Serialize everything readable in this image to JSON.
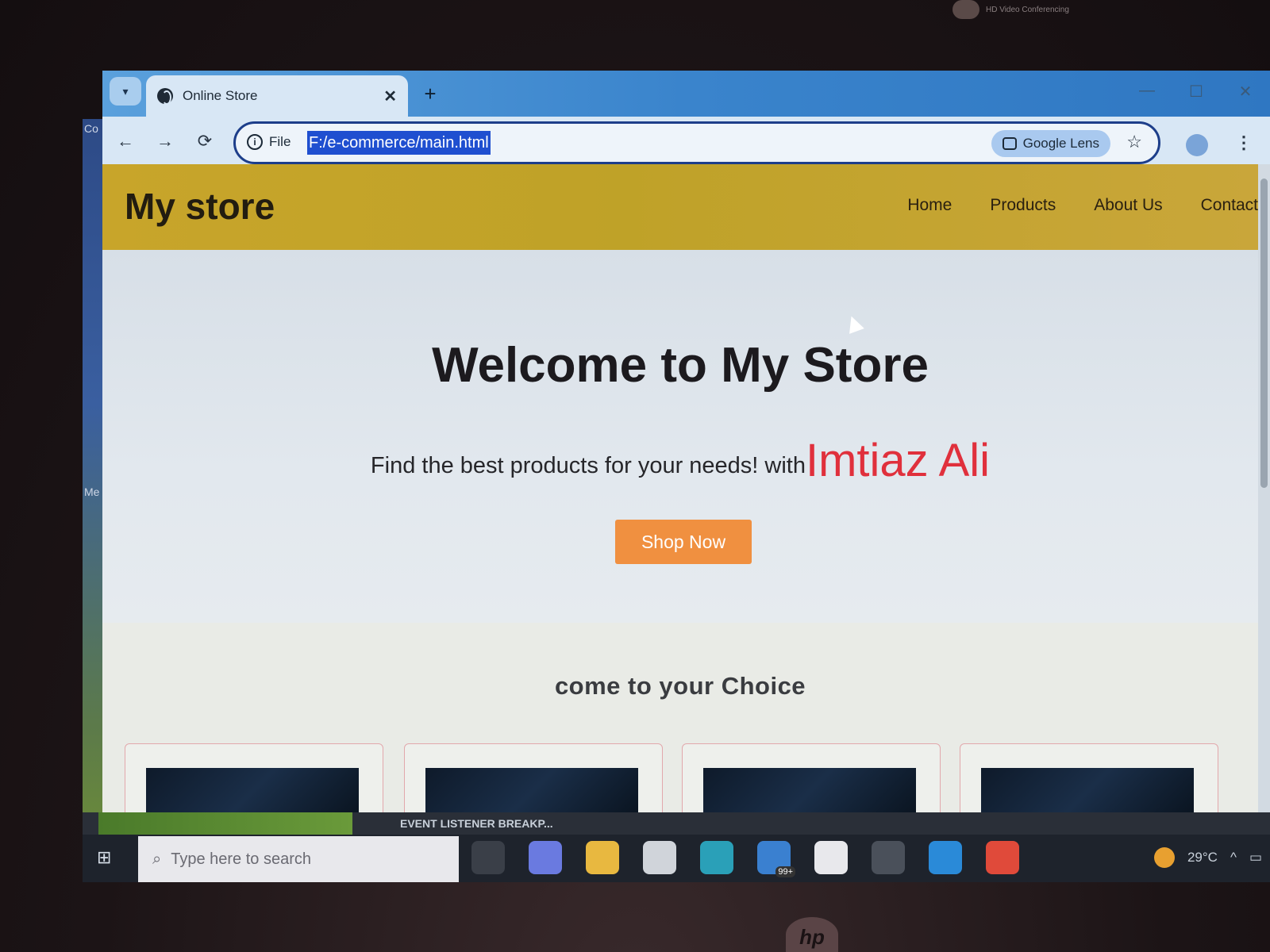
{
  "laptop": {
    "top_note": "HD Video Conferencing",
    "brand": "hp",
    "desktop_labels": [
      "Co",
      "Me"
    ]
  },
  "browser": {
    "tab_title": "Online Store",
    "tab_close": "✕",
    "new_tab": "+",
    "window_controls": [
      "—",
      "☐",
      "✕"
    ],
    "nav": {
      "back": "←",
      "forward": "→",
      "reload": "⟳"
    },
    "address": {
      "scheme_label": "File",
      "url": "F:/e-commerce/main.html"
    },
    "lens_label": "Google Lens",
    "bookmark_icon": "☆",
    "menu_icon": "⋮"
  },
  "site": {
    "logo": "My store",
    "nav": [
      "Home",
      "Products",
      "About Us",
      "Contact"
    ],
    "hero": {
      "title": "Welcome to My Store",
      "subtitle": "Find the best products for your needs! with",
      "highlight": "Imtiaz Ali",
      "button": "Shop Now"
    },
    "section_title": "come to your Choice",
    "colors": {
      "header": "#c8a52a",
      "button": "#f09040",
      "highlight": "#e0303c"
    }
  },
  "taskbar": {
    "strip_text": "EVENT LISTENER BREAKP...",
    "search_placeholder": "Type here to search",
    "badge": "99+",
    "temperature": "29°C"
  }
}
